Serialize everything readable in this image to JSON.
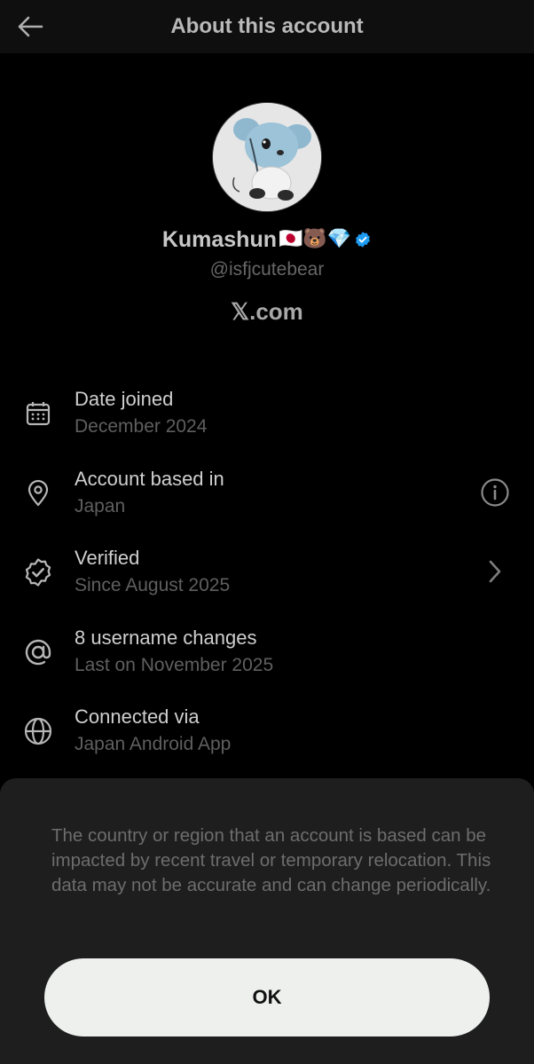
{
  "header": {
    "title": "About this account",
    "back_icon": "arrow-left-icon"
  },
  "profile": {
    "name": "Kumashun",
    "name_emojis": "🇯🇵🐻💎",
    "handle": "@isfjcutebear",
    "site": "𝕏.com",
    "verified_color": "#1d9bf0"
  },
  "rows": [
    {
      "icon": "calendar-icon",
      "title": "Date joined",
      "subtitle": "December 2024",
      "action": null
    },
    {
      "icon": "location-pin-icon",
      "title": "Account based in",
      "subtitle": "Japan",
      "action": "info-icon"
    },
    {
      "icon": "verified-badge-icon",
      "title": "Verified",
      "subtitle": "Since August 2025",
      "action": "chevron-right-icon"
    },
    {
      "icon": "at-sign-icon",
      "title": "8 username changes",
      "subtitle": "Last on November 2025",
      "action": null
    },
    {
      "icon": "globe-icon",
      "title": "Connected via",
      "subtitle": "Japan Android App",
      "action": null
    }
  ],
  "sheet": {
    "notice": "The country or region that an account is based can be impacted by recent travel or temporary relocation. This data may not be accurate and can change periodically.",
    "ok_label": "OK"
  }
}
